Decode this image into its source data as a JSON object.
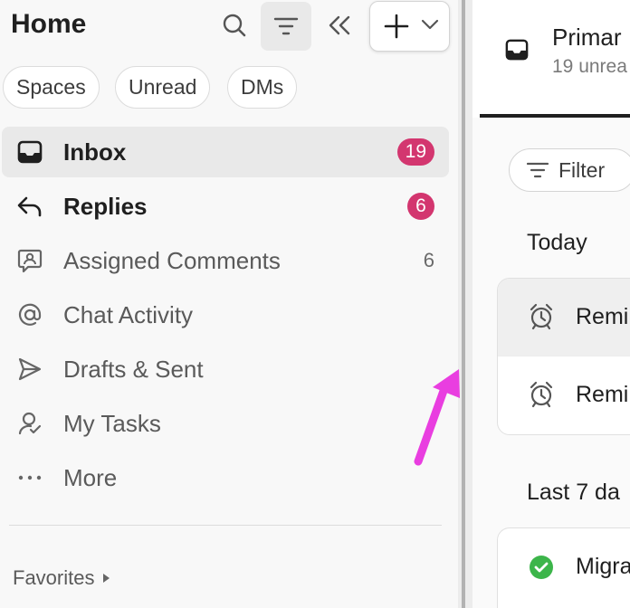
{
  "sidebar": {
    "title": "Home",
    "chips": [
      "Spaces",
      "Unread",
      "DMs"
    ],
    "items": [
      {
        "label": "Inbox",
        "badge": "19",
        "icon": "inbox-icon"
      },
      {
        "label": "Replies",
        "badge": "6",
        "icon": "reply-icon"
      },
      {
        "label": "Assigned Comments",
        "count": "6",
        "icon": "assigned-comments-icon"
      },
      {
        "label": "Chat Activity",
        "icon": "at-sign-icon"
      },
      {
        "label": "Drafts & Sent",
        "icon": "send-icon"
      },
      {
        "label": "My Tasks",
        "icon": "my-tasks-icon"
      },
      {
        "label": "More",
        "icon": "more-dots-icon"
      }
    ],
    "favorites_label": "Favorites"
  },
  "inbox_panel": {
    "title": "Primar",
    "subtitle": "19 unrea",
    "filter_label": "Filter",
    "sections": [
      {
        "title": "Today",
        "rows": [
          {
            "label": "Remi",
            "icon": "alarm-clock-icon"
          },
          {
            "label": "Remi",
            "icon": "alarm-clock-icon"
          }
        ]
      },
      {
        "title": "Last 7 da",
        "rows": [
          {
            "label": "Migra",
            "icon": "check-circle-icon"
          }
        ]
      }
    ]
  },
  "colors": {
    "badge": "#d3366f",
    "annotation_arrow": "#e93ee0",
    "success": "#3cb54a"
  }
}
